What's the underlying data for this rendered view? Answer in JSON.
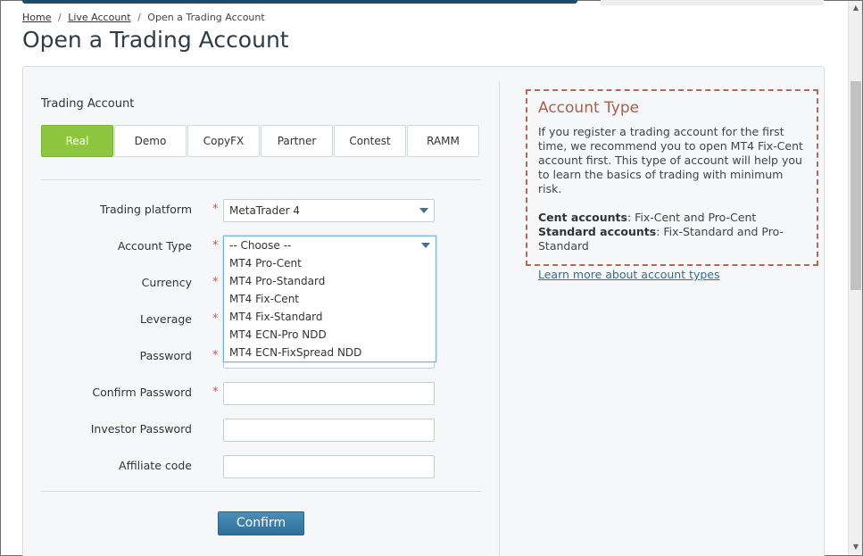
{
  "breadcrumb": {
    "home": "Home",
    "sep1": "/",
    "live": "Live Account",
    "sep2": "/",
    "current": "Open a Trading Account"
  },
  "page_title": "Open a Trading Account",
  "section_label": "Trading Account",
  "tabs": [
    {
      "label": "Real",
      "active": true
    },
    {
      "label": "Demo"
    },
    {
      "label": "CopyFX"
    },
    {
      "label": "Partner"
    },
    {
      "label": "Contest"
    },
    {
      "label": "RAMM"
    }
  ],
  "form": {
    "platform_label": "Trading platform",
    "platform_value": "MetaTrader 4",
    "account_type_label": "Account Type",
    "account_type_value": "-- Choose --",
    "currency_label": "Currency",
    "leverage_label": "Leverage",
    "password_label": "Password",
    "confirm_password_label": "Confirm Password",
    "investor_password_label": "Investor Password",
    "affiliate_code_label": "Affiliate code",
    "required_mark": "*"
  },
  "account_type_options": [
    "MT4 Pro-Cent",
    "MT4 Pro-Standard",
    "MT4 Fix-Cent",
    "MT4 Fix-Standard",
    "MT4 ECN-Pro NDD",
    "MT4 ECN-FixSpread NDD"
  ],
  "confirm_label": "Confirm",
  "info": {
    "title": "Account Type",
    "text": "If you register a trading account for the first time, we recommend you to open MT4 Fix-Cent account first. This type of account will help you to learn the basics of trading with minimum risk.",
    "cent_label": "Cent accounts",
    "cent_value": ": Fix-Cent and Pro-Cent",
    "standard_label": "Standard accounts",
    "standard_value": ": Fix-Standard and Pro-Standard",
    "link": "Learn more about account types"
  },
  "colors": {
    "active_tab": "#8dc63f",
    "button": "#2e6f98",
    "info_border": "#b06a55",
    "required": "#d9534f"
  },
  "icons": {
    "select_arrow": "chevron-down-icon",
    "scroll_up": "scroll-up-arrow-icon",
    "scroll_down": "scroll-down-arrow-icon"
  }
}
